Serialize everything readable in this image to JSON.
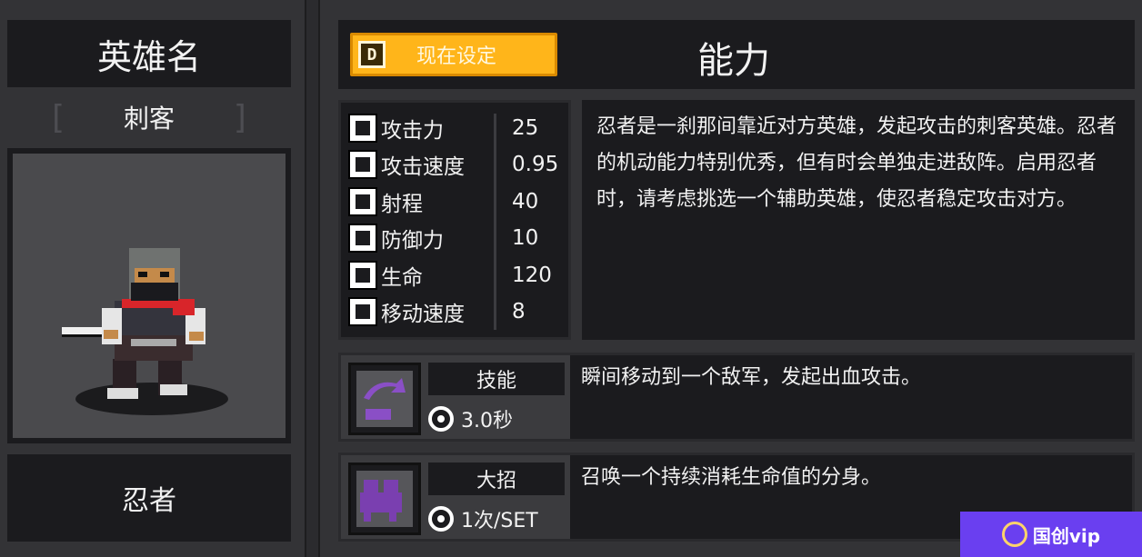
{
  "hero": {
    "name_title": "英雄名",
    "class_name": "刺客",
    "bracket_left": "[",
    "bracket_right": "]",
    "hero_name": "忍者"
  },
  "header": {
    "key_label": "D",
    "set_button_label": "现在设定",
    "title": "能力"
  },
  "stats": [
    {
      "icon": "sword-icon",
      "label": "攻击力",
      "value": "25"
    },
    {
      "icon": "attack-speed-icon",
      "label": "攻击速度",
      "value": "0.95"
    },
    {
      "icon": "range-icon",
      "label": "射程",
      "value": "40"
    },
    {
      "icon": "shield-icon",
      "label": "防御力",
      "value": "10"
    },
    {
      "icon": "health-cross-icon",
      "label": "生命",
      "value": "120"
    },
    {
      "icon": "boot-icon",
      "label": "移动速度",
      "value": "8"
    }
  ],
  "description": "忍者是一刹那间靠近对方英雄，发起攻击的刺客英雄。忍者的机动能力特别优秀，但有时会单独走进敌阵。启用忍者时，请考虑挑选一个辅助英雄，使忍者稳定攻击对方。",
  "skill": {
    "name": "技能",
    "cooldown": "3.0秒",
    "description": "瞬间移动到一个敌军，发起出血攻击。"
  },
  "ultimate": {
    "name": "大招",
    "cooldown": "1次/SET",
    "description": "召唤一个持续消耗生命值的分身。"
  },
  "watermark": {
    "text": "国创vip"
  },
  "colors": {
    "button_yellow": "#ffb51a",
    "panel_dark": "#1b1b1e",
    "panel_mid": "#333336",
    "skill_purple": "#7a3fb0",
    "watermark_purple": "#6a3ff0"
  }
}
